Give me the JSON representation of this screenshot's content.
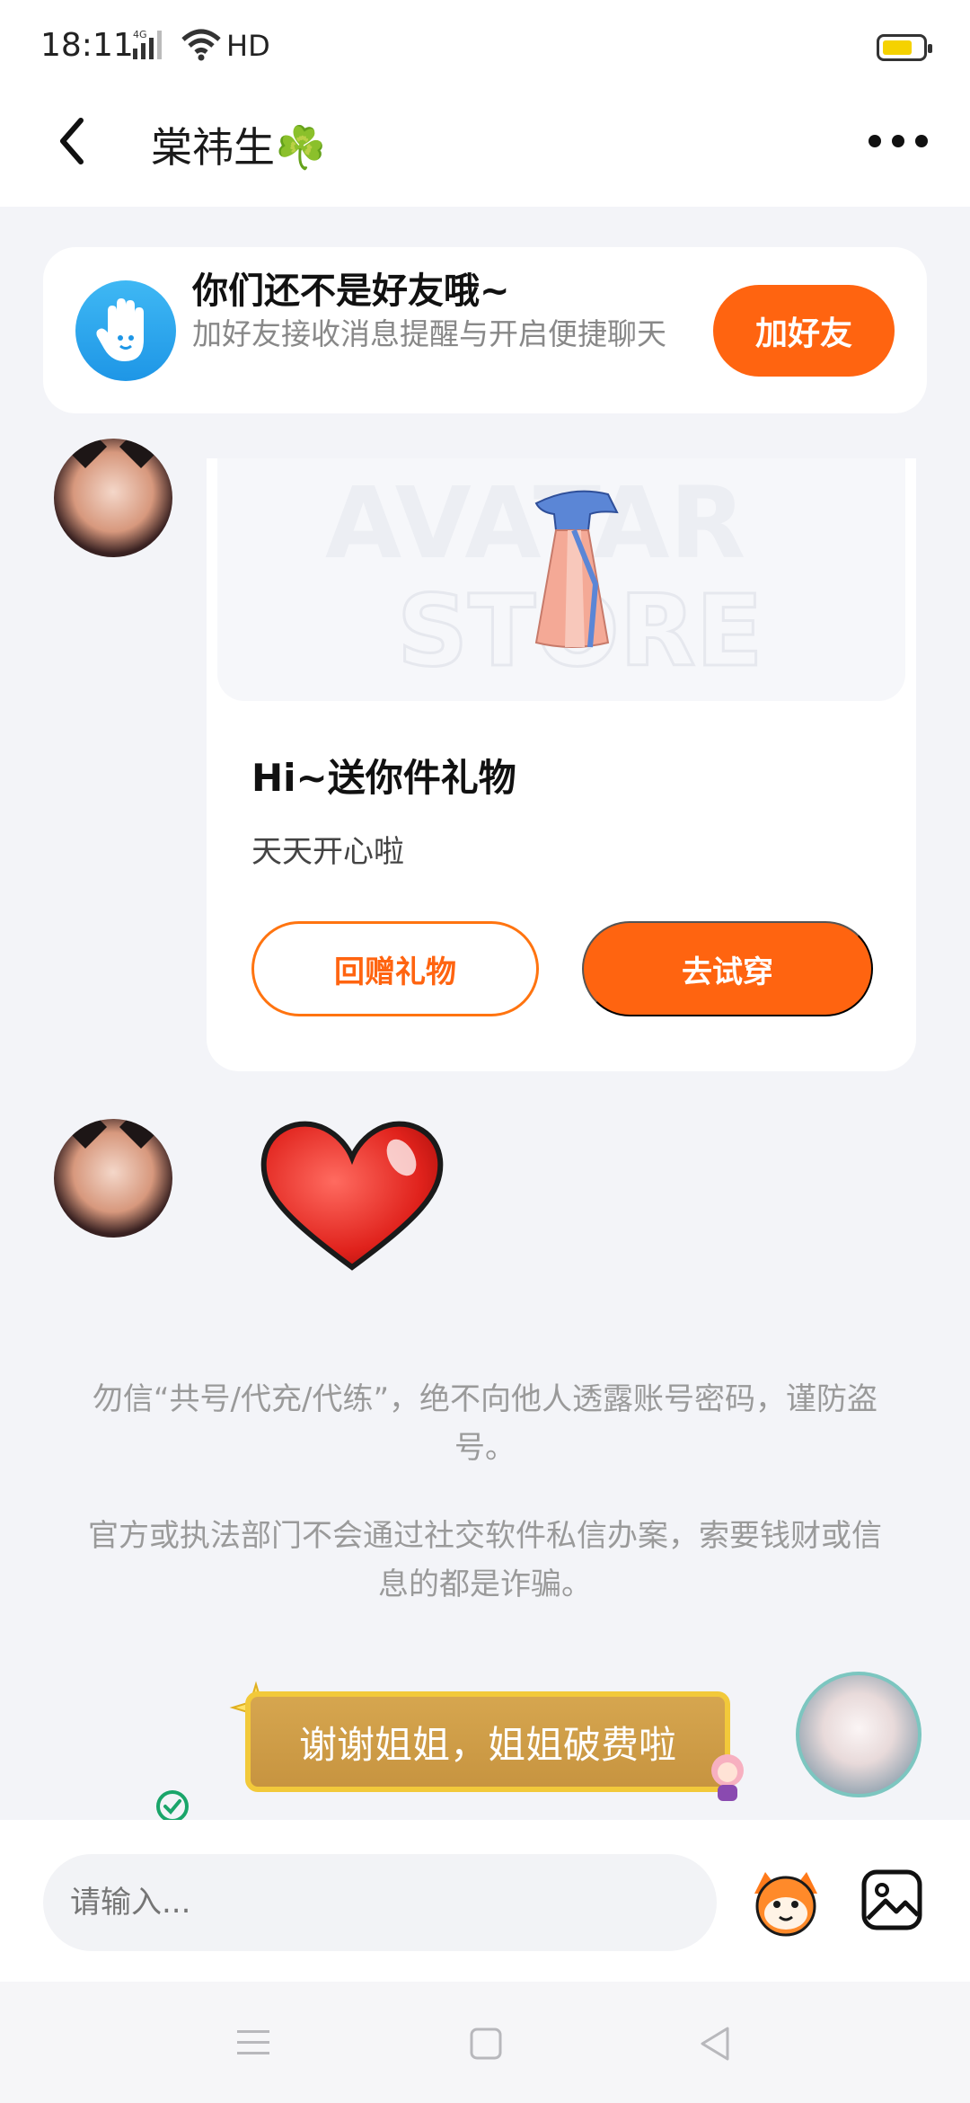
{
  "status_bar": {
    "time": "18:11",
    "network": "4G",
    "label": "HD",
    "battery_level": 0.75
  },
  "header": {
    "title": "棠祎生☘️"
  },
  "friend_banner": {
    "title": "你们还不是好友哦~",
    "subtitle": "加好友接收消息提醒与开启便捷聊天",
    "button": "加好友"
  },
  "gift_card": {
    "title": "Hi~送你件礼物",
    "subtitle": "天天开心啦",
    "return_button": "回赠礼物",
    "try_button": "去试穿"
  },
  "notices": [
    "勿信“共号/代充/代练”，绝不向他人透露账号密码，谨防盗号。",
    "官方或执法部门不会通过社交软件私信办案，索要钱财或信息的都是诈骗。"
  ],
  "my_message": {
    "text": "谢谢姐姐，姐姐破费啦"
  },
  "composer": {
    "placeholder": "请输入..."
  },
  "colors": {
    "accent": "#ff6410",
    "bubble": "#d6a64f",
    "bubble_border": "#f2c93a",
    "banner_icon": "#2aa6ee"
  }
}
